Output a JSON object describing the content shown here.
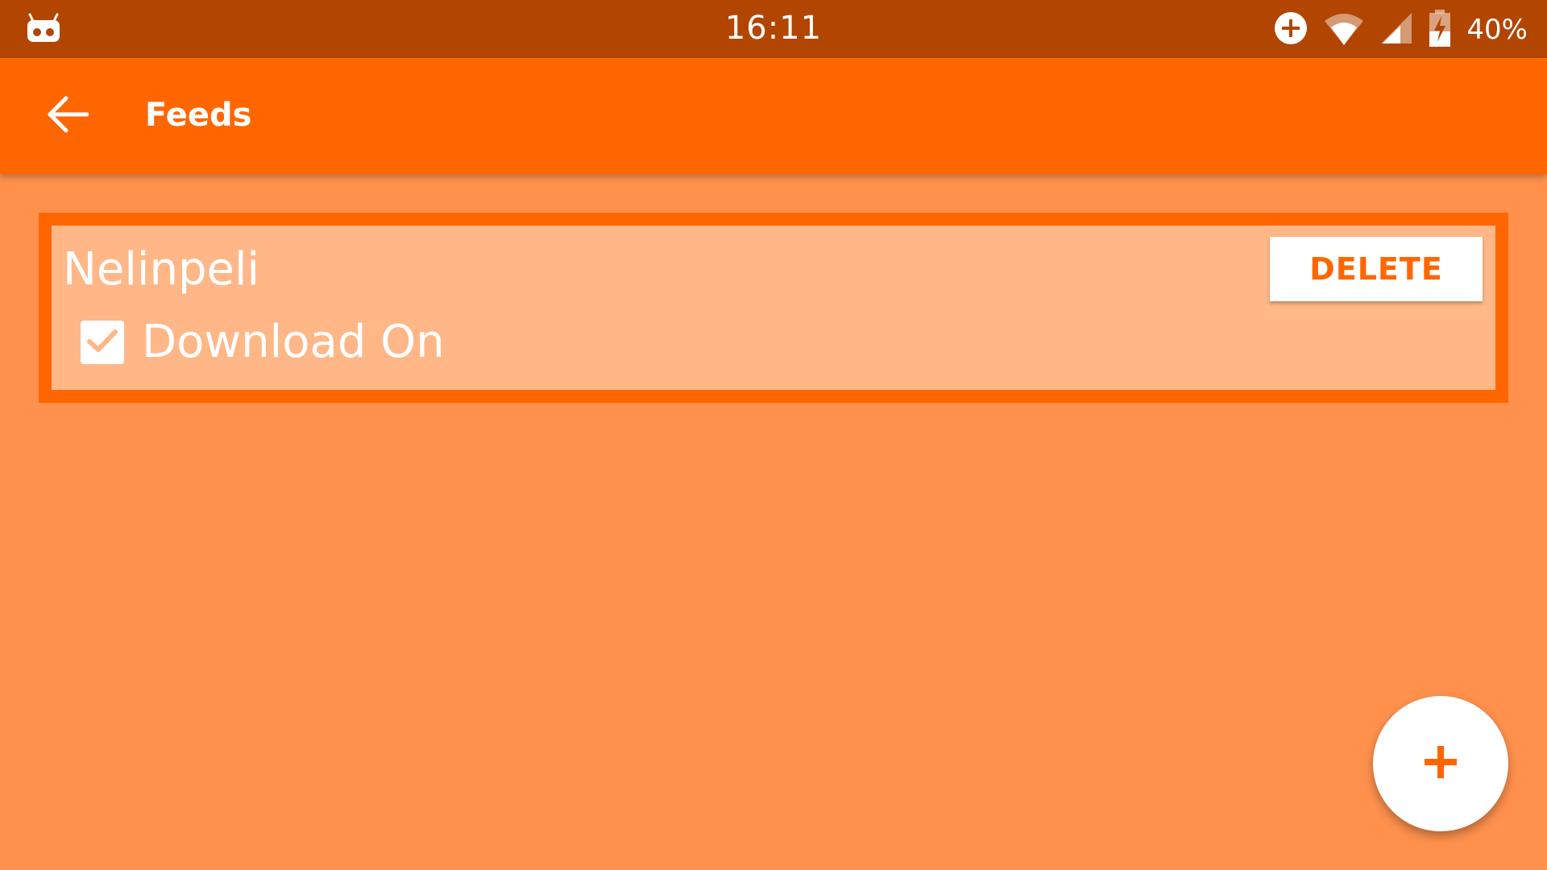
{
  "status_bar": {
    "time": "16:11",
    "battery_percent": "40%",
    "left_icon": "cyanogenmod-icon",
    "icons": [
      "data-saver-plus-icon",
      "wifi-icon",
      "cell-signal-icon",
      "battery-charging-icon"
    ]
  },
  "app_bar": {
    "title": "Feeds",
    "back_icon": "arrow-back-icon"
  },
  "feeds": [
    {
      "name": "Nelinpeli",
      "download_label": "Download On",
      "download_checked": true,
      "delete_label": "DELETE"
    }
  ],
  "fab": {
    "icon": "plus-icon"
  },
  "colors": {
    "status_bar": "#b24500",
    "app_bar": "#ff6600",
    "background": "#ff914d",
    "card_fill": "#ffb787",
    "accent": "#ff6600"
  }
}
